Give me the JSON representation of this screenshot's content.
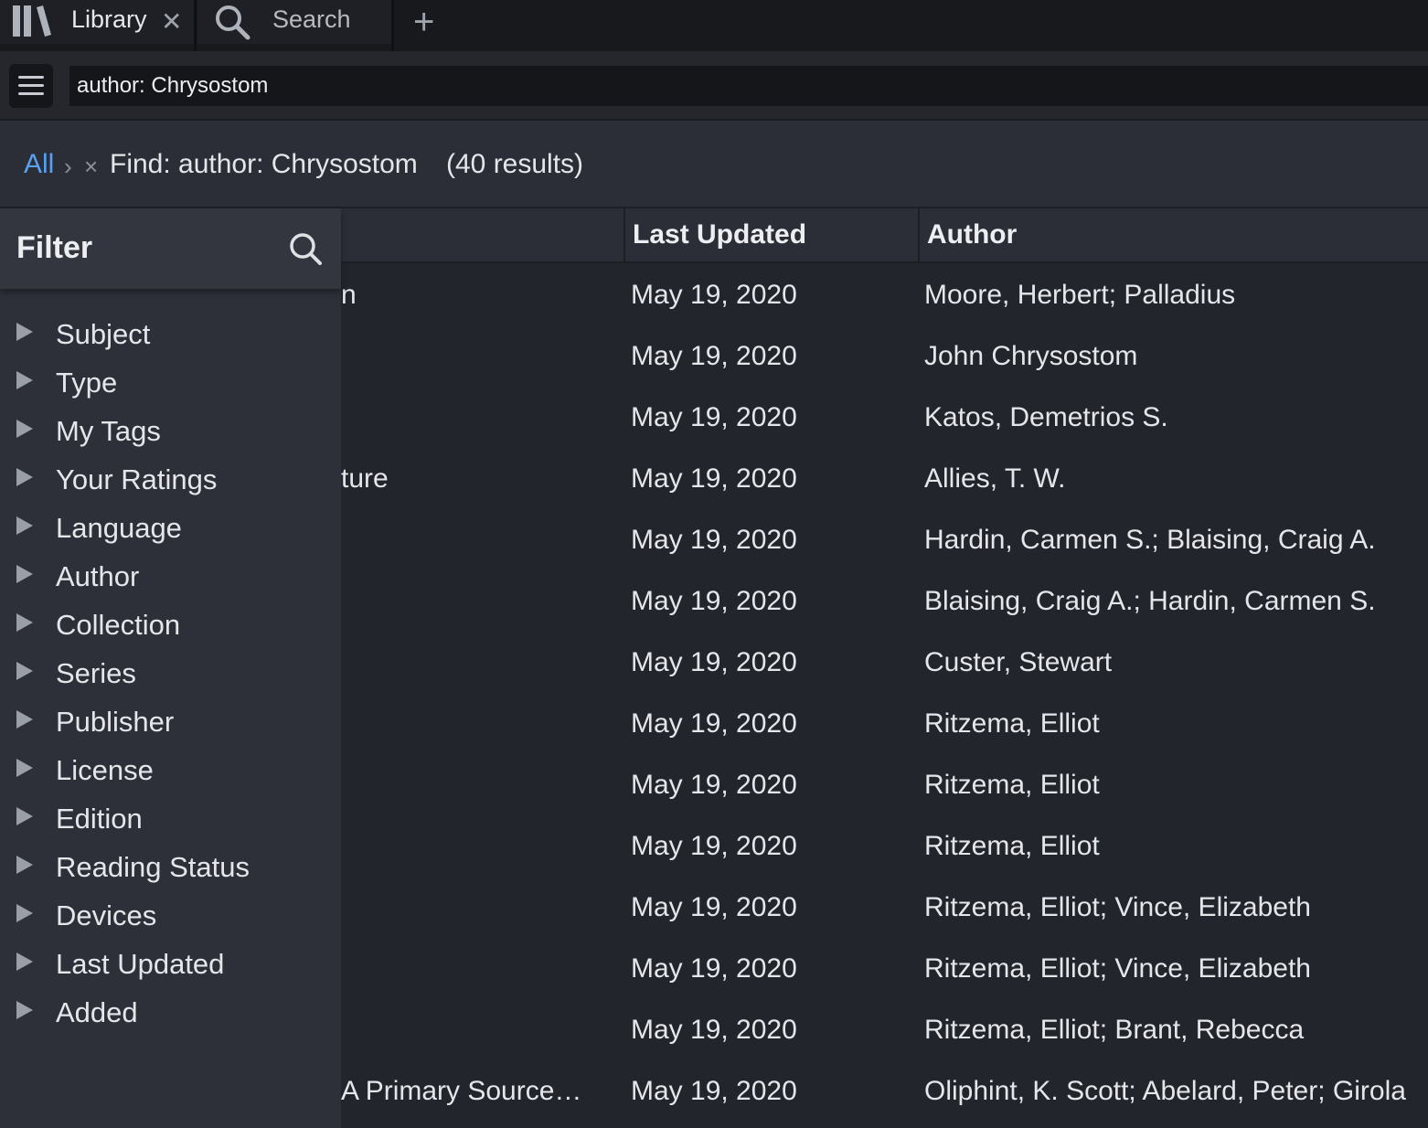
{
  "tabs": [
    {
      "label": "Library",
      "close": "✕",
      "icon": "library-books-icon"
    },
    {
      "label": "Search",
      "icon": "search-icon"
    }
  ],
  "new_tab": "+",
  "toolbar": {
    "menu_icon": "hamburger-menu-icon",
    "search_value": "author: Chrysostom"
  },
  "breadcrumb": {
    "root": "All",
    "separator": "›",
    "remove": "×",
    "filter": "Find: author: Chrysostom",
    "count": "(40 results)"
  },
  "filter": {
    "title": "Filter",
    "facets": [
      "Subject",
      "Type",
      "My Tags",
      "Your Ratings",
      "Language",
      "Author",
      "Collection",
      "Series",
      "Publisher",
      "License",
      "Edition",
      "Reading Status",
      "Devices",
      "Last Updated",
      "Added"
    ]
  },
  "table": {
    "columns": [
      "",
      "Last Updated",
      "Author"
    ],
    "rows": [
      {
        "title": "n",
        "updated": "May 19, 2020",
        "author": "Moore, Herbert; Palladius"
      },
      {
        "title": "",
        "updated": "May 19, 2020",
        "author": "John Chrysostom"
      },
      {
        "title": "",
        "updated": "May 19, 2020",
        "author": "Katos, Demetrios S."
      },
      {
        "title": "ture",
        "updated": "May 19, 2020",
        "author": "Allies, T. W."
      },
      {
        "title": "",
        "updated": "May 19, 2020",
        "author": "Hardin, Carmen S.; Blaising, Craig A."
      },
      {
        "title": "",
        "updated": "May 19, 2020",
        "author": "Blaising, Craig A.; Hardin, Carmen S."
      },
      {
        "title": "",
        "updated": "May 19, 2020",
        "author": "Custer, Stewart"
      },
      {
        "title": "",
        "updated": "May 19, 2020",
        "author": "Ritzema, Elliot"
      },
      {
        "title": "",
        "updated": "May 19, 2020",
        "author": "Ritzema, Elliot"
      },
      {
        "title": "",
        "updated": "May 19, 2020",
        "author": "Ritzema, Elliot"
      },
      {
        "title": "",
        "updated": "May 19, 2020",
        "author": "Ritzema, Elliot; Vince, Elizabeth"
      },
      {
        "title": "",
        "updated": "May 19, 2020",
        "author": "Ritzema, Elliot; Vince, Elizabeth"
      },
      {
        "title": "",
        "updated": "May 19, 2020",
        "author": "Ritzema, Elliot; Brant, Rebecca"
      },
      {
        "title": "A Primary Source…",
        "updated": "May 19, 2020",
        "author": "Oliphint, K. Scott; Abelard, Peter; Girola"
      }
    ]
  },
  "colors": {
    "accent": "#5aa0f0",
    "background": "#23252c",
    "panel": "#2d3039"
  }
}
